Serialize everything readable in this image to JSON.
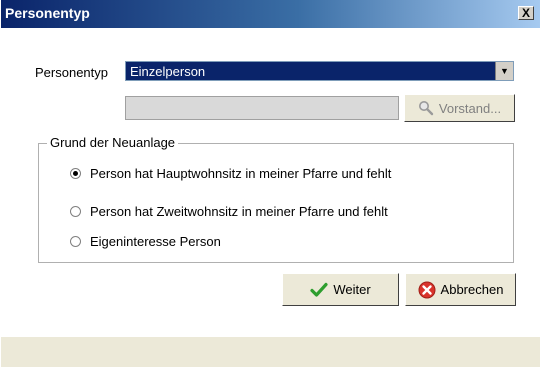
{
  "window": {
    "title": "Personentyp",
    "close_glyph": "X"
  },
  "form": {
    "personentyp_label": "Personentyp",
    "personentyp_selected": "Einzelperson",
    "vorstand_field_value": "",
    "vorstand_button_label": "Vorstand..."
  },
  "reason": {
    "legend": "Grund der Neuanlage",
    "options": [
      {
        "label": "Person hat Hauptwohnsitz in meiner Pfarre und fehlt",
        "selected": true
      },
      {
        "label": "Person hat Zweitwohnsitz in meiner Pfarre und fehlt",
        "selected": false
      },
      {
        "label": "Eigeninteresse Person",
        "selected": false
      }
    ]
  },
  "buttons": {
    "weiter_label": "Weiter",
    "abbrechen_label": "Abbrechen"
  },
  "icons": {
    "vorstand": "magnifier-icon",
    "weiter": "checkmark-icon",
    "abbrechen": "cancel-icon"
  },
  "colors": {
    "titlebar_start": "#0a246a",
    "select_highlight": "#0a246a",
    "check_green": "#2e9e2e",
    "cancel_red": "#d9332b"
  }
}
